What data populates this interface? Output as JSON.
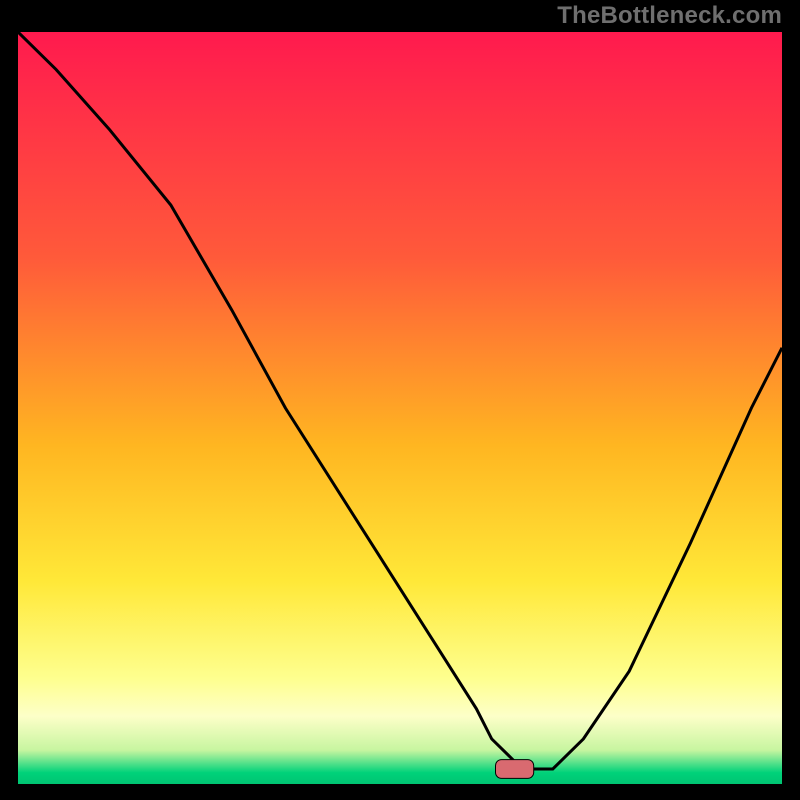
{
  "watermark": "TheBottleneck.com",
  "chart_data": {
    "type": "line",
    "title": "",
    "xlabel": "",
    "ylabel": "",
    "xlim": [
      0,
      100
    ],
    "ylim": [
      0,
      100
    ],
    "grid": false,
    "legend": false,
    "gradient_stops": [
      {
        "offset": 0.0,
        "color": "#ff1a4e"
      },
      {
        "offset": 0.3,
        "color": "#ff5a3a"
      },
      {
        "offset": 0.55,
        "color": "#ffb621"
      },
      {
        "offset": 0.73,
        "color": "#ffe838"
      },
      {
        "offset": 0.86,
        "color": "#feff8f"
      },
      {
        "offset": 0.91,
        "color": "#fdffc8"
      },
      {
        "offset": 0.955,
        "color": "#c7f5a0"
      },
      {
        "offset": 0.985,
        "color": "#00d27a"
      },
      {
        "offset": 1.0,
        "color": "#00c472"
      }
    ],
    "series": [
      {
        "name": "bottleneck-curve",
        "type": "line",
        "x": [
          0,
          5,
          12,
          20,
          28,
          35,
          45,
          55,
          60,
          62,
          65,
          67,
          70,
          74,
          80,
          88,
          96,
          100
        ],
        "y": [
          100,
          95,
          87,
          77,
          63,
          50,
          34,
          18,
          10,
          6,
          3,
          2,
          2,
          6,
          15,
          32,
          50,
          58
        ]
      }
    ],
    "marker": {
      "shape": "rounded-rect",
      "x": 65,
      "y": 2,
      "w": 5,
      "h": 2.5,
      "fill": "#d96a70",
      "stroke": "#000000"
    }
  }
}
